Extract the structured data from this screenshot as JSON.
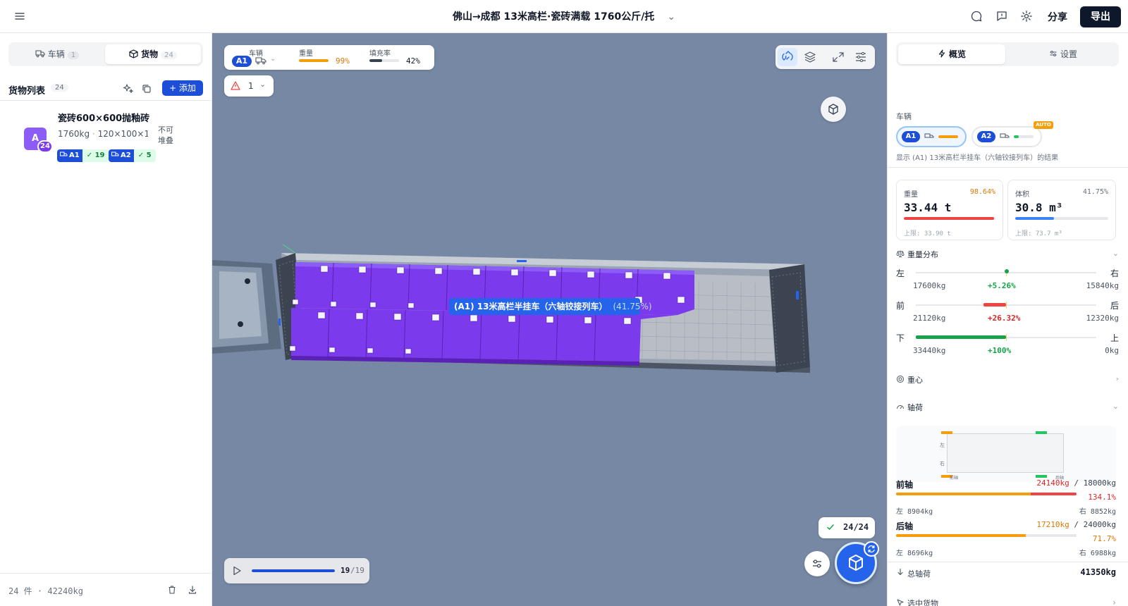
{
  "header": {
    "title": "佛山→成都 13米高栏·瓷砖满载 1760公斤/托",
    "share_label": "分享",
    "export_label": "导出"
  },
  "left_panel": {
    "tabs": [
      {
        "label": "车辆",
        "count": "1"
      },
      {
        "label": "货物",
        "count": "24"
      }
    ],
    "list_title": "货物列表",
    "list_count": "24",
    "add_label": "+ 添加",
    "items": [
      {
        "avatar": "A",
        "badge": "24",
        "name": "瓷砖600×600抛釉砖",
        "weight": "1760kg",
        "dims": "120×100×1…",
        "stack_line1": "不可",
        "stack_line2": "堆叠",
        "vehicle_tags": [
          {
            "vehicle": "A1",
            "count": "✓ 19"
          },
          {
            "vehicle": "A2",
            "count": "✓ 5"
          }
        ]
      }
    ],
    "footer_summary": "24 件 · 42240kg"
  },
  "viewport": {
    "status": {
      "vehicle_label": "车辆",
      "vehicle": "A1",
      "weight_label": "重量",
      "weight_pct": "99%",
      "weight_fill": 0.99,
      "fill_label": "填充率",
      "fill_pct": "42%",
      "fill_fill": 0.42
    },
    "warning_count": "1",
    "vehicle_caption": "(A1) 13米高栏半挂车（六轴铰接列车）",
    "vehicle_caption_pct": "(41.75%)",
    "packed_badge": "24/24",
    "playback": {
      "step": "19",
      "total": "/19",
      "progress": 1.0
    },
    "colors": {
      "cargo": "#7c3aed",
      "accent": "#2563eb",
      "viewport_bg": "#7688a4"
    }
  },
  "right_panel": {
    "tabs": [
      {
        "label": "概览"
      },
      {
        "label": "设置"
      }
    ],
    "vehicles_label": "车辆",
    "vehicles": [
      {
        "id": "A1",
        "load": 0.99,
        "color": "#f59e0b"
      },
      {
        "id": "A2",
        "load": 0.26,
        "color": "#22c55e"
      }
    ],
    "auto_label": "AUTO",
    "hint": "显示 (A1) 13米高栏半挂车（六轴铰接列车）的结果",
    "weight_card": {
      "label": "重量",
      "pct": "98.64%",
      "value": "33.44 t",
      "limit": "上限: 33.90 t",
      "fill": 0.9864,
      "color": "#ef4444"
    },
    "volume_card": {
      "label": "体积",
      "pct": "41.75%",
      "value": "30.8 m³",
      "limit": "上限: 73.7 m³",
      "fill": 0.4175,
      "color": "#3b82f6"
    },
    "distribution": {
      "title": "重量分布",
      "rows": [
        {
          "left_label": "左",
          "right_label": "右",
          "left_value": "17600kg",
          "center_value": "+5.26%",
          "right_value": "15840kg",
          "center_color": "#16a34a"
        },
        {
          "left_label": "前",
          "right_label": "后",
          "left_value": "21120kg",
          "center_value": "+26.32%",
          "right_value": "12320kg",
          "center_color": "#dc2626"
        },
        {
          "left_label": "下",
          "right_label": "上",
          "left_value": "33440kg",
          "center_value": "+100%",
          "right_value": "0kg",
          "center_color": "#16a34a"
        }
      ]
    },
    "cog_label": "重心",
    "axle_section": {
      "title": "轴荷",
      "diagram_left": "左",
      "diagram_right": "右",
      "diagram_front": "前轴",
      "diagram_rear": "后轴"
    },
    "axles": [
      {
        "name": "前轴",
        "value": "24140kg",
        "limit": " / 18000kg",
        "pct": "134.1%",
        "left": "左 8904kg",
        "right": "右 8852kg",
        "value_color": "#dc2626"
      },
      {
        "name": "后轴",
        "value": "17210kg",
        "limit": " / 24000kg",
        "pct": "71.7%",
        "left": "左 8696kg",
        "right": "右 6988kg",
        "value_color": "#f59e0b"
      }
    ],
    "total_label": "总轴荷",
    "total_value": "41350kg",
    "selected_label": "选中货物"
  }
}
